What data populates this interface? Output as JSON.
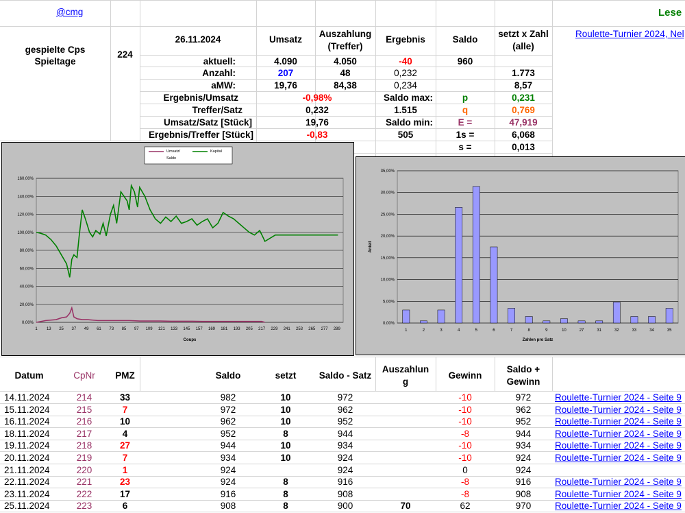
{
  "header": {
    "cmg_link": "@cmg",
    "lese": "Lese",
    "turnier_link": "Roulette-Turnier 2024, Nel"
  },
  "left_info": {
    "label_cps": "gespielte Cps",
    "label_tage": "Spieltage",
    "value": "224"
  },
  "summary": {
    "date": "26.11.2024",
    "col_umsatz": "Umsatz",
    "col_auszahlung": "Auszahlung",
    "col_auszahlung2": "(Treffer)",
    "col_ergebnis": "Ergebnis",
    "col_saldo": "Saldo",
    "col_setzt": "setzt x Zahl",
    "col_setzt2": "(alle)",
    "rows": [
      {
        "label": "aktuell:",
        "umsatz": "4.090",
        "auszahlung": "4.050",
        "ergebnis": "-40",
        "saldo": "960",
        "setzt": ""
      },
      {
        "label": "Anzahl:",
        "umsatz": "207",
        "auszahlung": "48",
        "ergebnis": "0,232",
        "saldo": "",
        "setzt": "1.773"
      },
      {
        "label": "aMW:",
        "umsatz": "19,76",
        "auszahlung": "84,38",
        "ergebnis": "0,234",
        "saldo": "",
        "setzt": "8,57"
      }
    ],
    "ergebnis_umsatz_label": "Ergebnis/Umsatz",
    "ergebnis_umsatz_value": "-0,98%",
    "treffer_satz_label": "Treffer/Satz",
    "treffer_satz_value": "0,232",
    "umsatz_satz_label": "Umsatz/Satz [Stück]",
    "umsatz_satz_value": "19,76",
    "ergebnis_treffer_label": "Ergebnis/Treffer [Stück]",
    "ergebnis_treffer_value": "-0,83",
    "saldo_max_label": "Saldo max:",
    "saldo_max_value": "1.515",
    "saldo_min_label": "Saldo min:",
    "saldo_min_value": "505",
    "p_label": "p",
    "p_value": "0,231",
    "q_label": "q",
    "q_value": "0,769",
    "e_label": "E =",
    "e_value": "47,919",
    "s1_label": "1s =",
    "s1_value": "6,068",
    "s_label": "s =",
    "s_value": "0,013"
  },
  "chart_data": [
    {
      "type": "line",
      "legend": [
        "Umsatz/ Saldo",
        "Kapital"
      ],
      "xlabel": "Coups",
      "ylabel": "",
      "ylim": [
        0,
        160
      ],
      "yticks": [
        "0,00%",
        "20,00%",
        "40,00%",
        "60,00%",
        "80,00%",
        "100,00%",
        "120,00%",
        "140,00%",
        "160,00%"
      ],
      "xticks": [
        "1",
        "13",
        "25",
        "37",
        "49",
        "61",
        "73",
        "85",
        "97",
        "109",
        "121",
        "133",
        "145",
        "157",
        "169",
        "181",
        "193",
        "205",
        "217",
        "229",
        "241",
        "253",
        "265",
        "277",
        "289"
      ],
      "series": [
        {
          "name": "Umsatz/ Saldo",
          "color": "#993366",
          "x": [
            1,
            10,
            20,
            25,
            30,
            33,
            35,
            37,
            40,
            45,
            50,
            60,
            70,
            80,
            90,
            100,
            110,
            120,
            130,
            140,
            150,
            160,
            170,
            180,
            190,
            200,
            210,
            217,
            220
          ],
          "y": [
            0,
            2,
            3,
            5,
            6,
            10,
            16,
            6,
            4,
            3,
            3,
            2,
            2,
            2,
            2,
            1.5,
            1.5,
            1.5,
            1.2,
            1.2,
            1.2,
            1,
            1,
            1,
            1,
            1,
            1,
            1,
            0
          ]
        },
        {
          "name": "Kapital",
          "color": "#008000",
          "x": [
            1,
            5,
            10,
            15,
            20,
            25,
            30,
            33,
            35,
            37,
            40,
            42,
            45,
            48,
            52,
            55,
            58,
            62,
            65,
            68,
            72,
            75,
            78,
            82,
            85,
            88,
            90,
            92,
            95,
            98,
            100,
            105,
            110,
            115,
            120,
            125,
            130,
            135,
            140,
            145,
            150,
            155,
            160,
            165,
            170,
            175,
            180,
            185,
            190,
            195,
            200,
            205,
            210,
            215,
            218,
            220,
            230,
            240,
            250,
            260,
            270,
            280,
            290
          ],
          "y": [
            100,
            99,
            97,
            92,
            85,
            75,
            65,
            50,
            70,
            75,
            72,
            95,
            125,
            115,
            100,
            95,
            102,
            98,
            110,
            96,
            120,
            130,
            110,
            145,
            140,
            135,
            125,
            152,
            145,
            128,
            150,
            140,
            125,
            115,
            110,
            117,
            112,
            118,
            110,
            112,
            115,
            108,
            112,
            115,
            105,
            110,
            122,
            118,
            115,
            110,
            105,
            100,
            97,
            102,
            95,
            90,
            97,
            97,
            97,
            97,
            97,
            97,
            97
          ]
        }
      ]
    },
    {
      "type": "bar",
      "ylabel": "Anteil",
      "xlabel": "Zahlen pro Satz",
      "ylim": [
        0,
        35
      ],
      "yticks": [
        "0,00%",
        "5,00%",
        "10,00%",
        "15,00%",
        "20,00%",
        "25,00%",
        "30,00%",
        "35,00%"
      ],
      "categories": [
        "1",
        "2",
        "3",
        "4",
        "5",
        "6",
        "7",
        "8",
        "9",
        "10",
        "27",
        "31",
        "32",
        "33",
        "34",
        "35"
      ],
      "values": [
        3.0,
        0.5,
        3.0,
        26.6,
        31.4,
        17.5,
        3.4,
        1.5,
        0.5,
        1.0,
        0.5,
        0.5,
        4.8,
        1.5,
        1.5,
        3.4
      ],
      "bar_color": "#9999ff"
    }
  ],
  "table": {
    "headers": {
      "datum": "Datum",
      "cpnr": "CpNr",
      "pmz": "PMZ",
      "saldo": "Saldo",
      "setzt": "setzt",
      "saldo_satz": "Saldo - Satz",
      "auszahlung": "Auszahlun",
      "auszahlung2": "g",
      "gewinn": "Gewinn",
      "saldo_gewinn": "Saldo +",
      "saldo_gewinn2": "Gewinn"
    },
    "rows": [
      {
        "datum": "14.11.2024",
        "cpnr": "214",
        "pmz": "33",
        "pmzred": false,
        "saldo": "982",
        "setzt": "10",
        "ss": "972",
        "ausz": "",
        "gewinn": "-10",
        "sg": "972",
        "link": "Roulette-Turnier 2024 - Seite 9"
      },
      {
        "datum": "15.11.2024",
        "cpnr": "215",
        "pmz": "7",
        "pmzred": true,
        "saldo": "972",
        "setzt": "10",
        "ss": "962",
        "ausz": "",
        "gewinn": "-10",
        "sg": "962",
        "link": "Roulette-Turnier 2024 - Seite 9"
      },
      {
        "datum": "16.11.2024",
        "cpnr": "216",
        "pmz": "10",
        "pmzred": false,
        "saldo": "962",
        "setzt": "10",
        "ss": "952",
        "ausz": "",
        "gewinn": "-10",
        "sg": "952",
        "link": "Roulette-Turnier 2024 - Seite 9"
      },
      {
        "datum": "18.11.2024",
        "cpnr": "217",
        "pmz": "4",
        "pmzred": false,
        "saldo": "952",
        "setzt": "8",
        "ss": "944",
        "ausz": "",
        "gewinn": "-8",
        "sg": "944",
        "link": "Roulette-Turnier 2024 - Seite 9"
      },
      {
        "datum": "19.11.2024",
        "cpnr": "218",
        "pmz": "27",
        "pmzred": true,
        "saldo": "944",
        "setzt": "10",
        "ss": "934",
        "ausz": "",
        "gewinn": "-10",
        "sg": "934",
        "link": "Roulette-Turnier 2024 - Seite 9"
      },
      {
        "datum": "20.11.2024",
        "cpnr": "219",
        "pmz": "7",
        "pmzred": true,
        "saldo": "934",
        "setzt": "10",
        "ss": "924",
        "ausz": "",
        "gewinn": "-10",
        "sg": "924",
        "link": "Roulette-Turnier 2024 - Seite 9"
      },
      {
        "datum": "21.11.2024",
        "cpnr": "220",
        "pmz": "1",
        "pmzred": true,
        "saldo": "924",
        "setzt": "",
        "ss": "924",
        "ausz": "",
        "gewinn": "0",
        "sg": "924",
        "link": ""
      },
      {
        "datum": "22.11.2024",
        "cpnr": "221",
        "pmz": "23",
        "pmzred": true,
        "saldo": "924",
        "setzt": "8",
        "ss": "916",
        "ausz": "",
        "gewinn": "-8",
        "sg": "916",
        "link": "Roulette-Turnier 2024 - Seite 9"
      },
      {
        "datum": "23.11.2024",
        "cpnr": "222",
        "pmz": "17",
        "pmzred": false,
        "saldo": "916",
        "setzt": "8",
        "ss": "908",
        "ausz": "",
        "gewinn": "-8",
        "sg": "908",
        "link": "Roulette-Turnier 2024 - Seite 9"
      },
      {
        "datum": "25.11.2024",
        "cpnr": "223",
        "pmz": "6",
        "pmzred": false,
        "saldo": "908",
        "setzt": "8",
        "ss": "900",
        "ausz": "70",
        "gewinn": "62",
        "sg": "970",
        "link": "Roulette-Turnier 2024 - Seite 9"
      }
    ]
  }
}
